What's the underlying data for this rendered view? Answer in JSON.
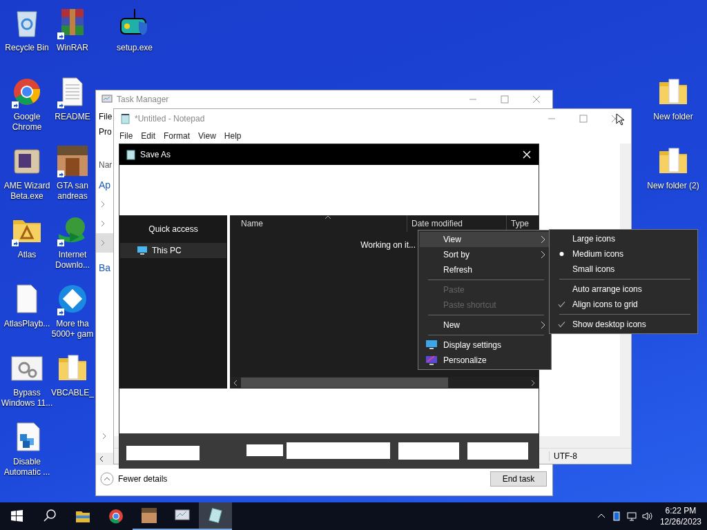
{
  "desktop": {
    "icons": [
      {
        "label": "Recycle Bin",
        "kind": "recycle-bin",
        "shortcut": false
      },
      {
        "label": "WinRAR",
        "kind": "archive",
        "shortcut": true
      },
      {
        "label": "setup.exe",
        "kind": "gamepad",
        "shortcut": false
      },
      {
        "label": "Google Chrome",
        "kind": "chrome",
        "shortcut": true
      },
      {
        "label": "README",
        "kind": "document",
        "shortcut": true
      },
      {
        "label": "AME Wizard Beta.exe",
        "kind": "box",
        "shortcut": false
      },
      {
        "label": "GTA san andreas",
        "kind": "photo",
        "shortcut": true
      },
      {
        "label": "Atlas",
        "kind": "folder-app",
        "shortcut": true
      },
      {
        "label": "Internet Downlo...",
        "kind": "globe",
        "shortcut": true
      },
      {
        "label": "AtlasPlayb...",
        "kind": "file",
        "shortcut": false
      },
      {
        "label": "More tha 5000+ gam",
        "kind": "game-circle",
        "shortcut": true
      },
      {
        "label": "Bypass Windows 11...",
        "kind": "gears",
        "shortcut": false
      },
      {
        "label": "VBCABLE_",
        "kind": "folder",
        "shortcut": false
      },
      {
        "label": "Disable Automatic ...",
        "kind": "cubes",
        "shortcut": false
      },
      {
        "label": "New folder",
        "kind": "folder",
        "shortcut": false
      },
      {
        "label": "New folder (2)",
        "kind": "folder",
        "shortcut": false
      }
    ]
  },
  "task_manager": {
    "title": "Task Manager",
    "menu": "File",
    "tab": "Pro",
    "column": "Nar",
    "group_1": "Ap",
    "rows": [
      {
        "selected": false
      },
      {
        "selected": false
      },
      {
        "selected": true
      }
    ],
    "group_2": "Ba",
    "toggle": "Fewer details",
    "button": "End task"
  },
  "notepad": {
    "title": "*Untitled - Notepad",
    "menu": [
      "File",
      "Edit",
      "Format",
      "View",
      "Help"
    ],
    "encoding": "UTF-8"
  },
  "save_as": {
    "title": "Save As",
    "nav": [
      {
        "label": "Quick access",
        "selected": false
      },
      {
        "label": "This PC",
        "selected": true
      }
    ],
    "columns": [
      "Name",
      "Date modified",
      "Type"
    ],
    "status": "Working on it..."
  },
  "context_menu": {
    "items": [
      {
        "kind": "item",
        "label": "View",
        "submenu": true,
        "selected": true,
        "disabled": false
      },
      {
        "kind": "item",
        "label": "Sort by",
        "submenu": true,
        "selected": false,
        "disabled": false
      },
      {
        "kind": "item",
        "label": "Refresh",
        "submenu": false,
        "selected": false,
        "disabled": false
      },
      {
        "kind": "separator"
      },
      {
        "kind": "item",
        "label": "Paste",
        "submenu": false,
        "selected": false,
        "disabled": true
      },
      {
        "kind": "item",
        "label": "Paste shortcut",
        "submenu": false,
        "selected": false,
        "disabled": true
      },
      {
        "kind": "separator"
      },
      {
        "kind": "item",
        "label": "New",
        "submenu": true,
        "selected": false,
        "disabled": false
      },
      {
        "kind": "separator"
      },
      {
        "kind": "display",
        "label": "Display settings",
        "submenu": false,
        "selected": false,
        "disabled": false
      },
      {
        "kind": "personalize",
        "label": "Personalize",
        "submenu": false,
        "selected": false,
        "disabled": false
      }
    ]
  },
  "view_submenu": {
    "items": [
      {
        "kind": "radio",
        "label": "Large icons",
        "selected": false
      },
      {
        "kind": "radio",
        "label": "Medium icons",
        "selected": true
      },
      {
        "kind": "radio",
        "label": "Small icons",
        "selected": false
      },
      {
        "kind": "separator"
      },
      {
        "kind": "check",
        "label": "Auto arrange icons",
        "checked": false
      },
      {
        "kind": "check",
        "label": "Align icons to grid",
        "checked": true
      },
      {
        "kind": "separator"
      },
      {
        "kind": "check",
        "label": "Show desktop icons",
        "checked": true
      }
    ]
  },
  "taskbar": {
    "apps": [
      {
        "kind": "explorer",
        "open": false,
        "active": false
      },
      {
        "kind": "chrome",
        "open": false,
        "active": false
      },
      {
        "kind": "photo",
        "open": true,
        "active": false
      },
      {
        "kind": "monitor",
        "open": true,
        "active": false
      },
      {
        "kind": "notepad",
        "open": true,
        "active": true
      }
    ],
    "time": "6:22 PM",
    "date": "12/26/2023"
  }
}
